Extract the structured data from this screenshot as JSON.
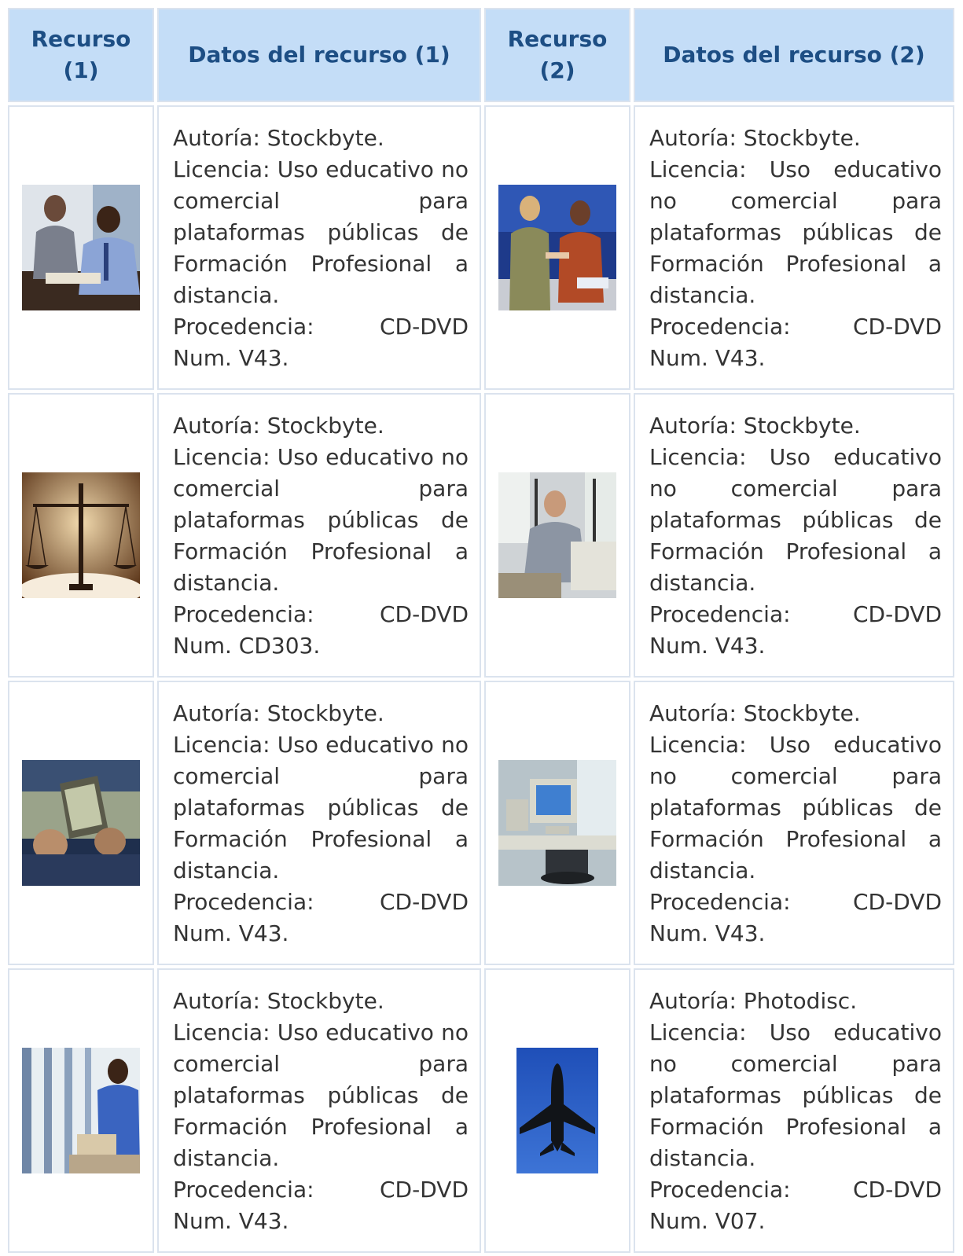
{
  "headers": {
    "col1": "Recurso (1)",
    "col2": "Datos del recurso (1)",
    "col3": "Recurso (2)",
    "col4": "Datos del recurso (2)"
  },
  "rows": [
    {
      "left": {
        "image": "people-reviewing-documents-photo",
        "autoria": "Autoría: Stockbyte.",
        "licencia": "Licencia: Uso educativo no comercial para plataformas públicas de Formación Profesional a distancia.",
        "procedencia": "Procedencia: CD-DVD Num. V43."
      },
      "right": {
        "image": "people-handshake-office-photo",
        "autoria": "Autoría: Stockbyte.",
        "licencia": "Licencia: Uso educativo no comercial para plataformas públicas de Formación Profesional a distancia.",
        "procedencia": "Procedencia: CD-DVD Num. V43."
      }
    },
    {
      "left": {
        "image": "scales-of-justice-photo",
        "autoria": "Autoría: Stockbyte.",
        "licencia": "Licencia: Uso educativo no comercial para plataformas públicas de Formación Profesional a distancia.",
        "procedencia": "Procedencia: CD-DVD Num. CD303."
      },
      "right": {
        "image": "man-at-computer-photo",
        "autoria": "Autoría: Stockbyte.",
        "licencia": "Licencia: Uso educativo no comercial para plataformas públicas de Formación Profesional a distancia.",
        "procedencia": "Procedencia: CD-DVD Num. V43."
      }
    },
    {
      "left": {
        "image": "hands-holding-handheld-device-photo",
        "autoria": "Autoría: Stockbyte.",
        "licencia": "Licencia: Uso educativo no comercial para plataformas públicas de Formación Profesional a distancia.",
        "procedencia": "Procedencia: CD-DVD Num. V43."
      },
      "right": {
        "image": "office-desk-computer-photo",
        "autoria": "Autoría: Stockbyte.",
        "licencia": "Licencia: Uso educativo no comercial para plataformas públicas de Formación Profesional a distancia.",
        "procedencia": "Procedencia: CD-DVD Num. V43."
      }
    },
    {
      "left": {
        "image": "man-reading-by-window-photo",
        "autoria": "Autoría: Stockbyte.",
        "licencia": "Licencia: Uso educativo no comercial para plataformas públicas de Formación Profesional a distancia.",
        "procedencia": "Procedencia: CD-DVD Num. V43."
      },
      "right": {
        "image": "airplane-from-below-photo",
        "autoria": "Autoría: Photodisc.",
        "licencia": "Licencia: Uso educativo no comercial para plataformas públicas de Formación Profesional a distancia.",
        "procedencia": "Procedencia: CD-DVD Num. V07."
      }
    }
  ],
  "colors": {
    "header_bg": "#c4ddf7",
    "header_text": "#1d4e84",
    "cell_border": "#dbe3ee",
    "body_text": "#343434"
  }
}
